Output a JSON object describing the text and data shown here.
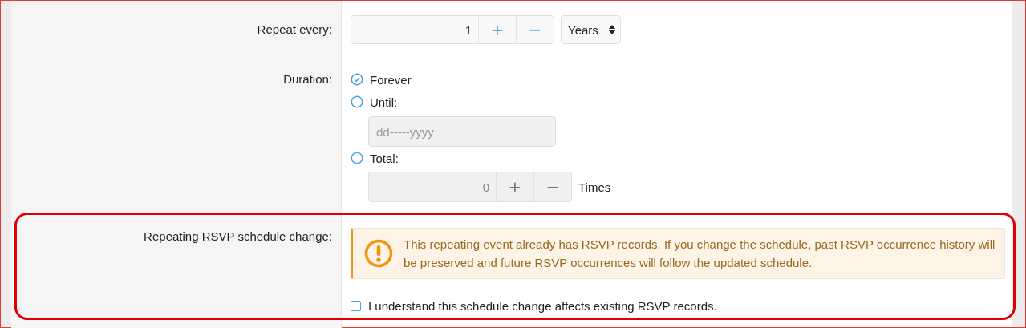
{
  "rows": [
    {
      "kind": "repeat",
      "label": "Repeat every:",
      "value": "1",
      "plus": "+",
      "minus": "−",
      "unit": "Years"
    },
    {
      "kind": "duration",
      "label": "Duration:",
      "options": [
        {
          "label": "Forever",
          "selected": true
        },
        {
          "label": "Until:",
          "selected": false,
          "field": {
            "placeholder": "dd-----yyyy",
            "disabled": true
          }
        },
        {
          "label": "Total:",
          "selected": false,
          "stepper": {
            "value": "0",
            "plus": "+",
            "minus": "−",
            "suffix": "Times",
            "disabled": true
          }
        }
      ]
    },
    {
      "kind": "notice",
      "label": "Repeating RSVP schedule change:",
      "highlighted": true,
      "warning": "This repeating event already has RSVP records. If you change the schedule, past RSVP occurrence history will be preserved and future RSVP occurrences will follow the updated schedule.",
      "checkbox": {
        "label": "I understand this schedule change affects existing RSVP records.",
        "checked": false
      }
    }
  ]
}
